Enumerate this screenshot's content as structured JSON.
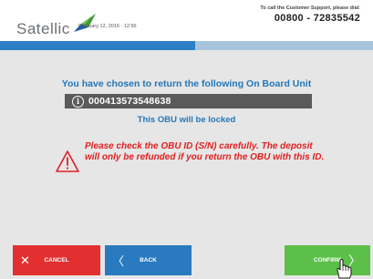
{
  "header": {
    "brand": "Satellic",
    "date": "February 12, 2016 - 12:56",
    "support_label": "To call the Customer Support, please dial:",
    "support_phone": "00800 - 72835542"
  },
  "main": {
    "title": "You have chosen to return the following On Board Unit",
    "info_glyph": "i",
    "obu_id": "000413573548638",
    "locked_text": "This OBU will be locked",
    "warning_text": "Please check the OBU ID (S/N) carefully. The deposit will only be refunded if you return the OBU with this ID."
  },
  "footer": {
    "cancel_label": "CANCEL",
    "back_label": "BACK",
    "confirm_label": "CONFIRM"
  },
  "icons": {
    "cancel": "close-icon",
    "back": "chevron-left-icon",
    "confirm": "chevron-right-icon",
    "warning": "warning-triangle-icon",
    "info": "info-icon",
    "cursor": "hand-pointer-icon"
  },
  "colors": {
    "accent_blue": "#2277b9",
    "progress_dark": "#2c7fc4",
    "progress_light": "#a9c4dd",
    "warning_red": "#e02020",
    "cancel_red": "#e23030",
    "back_blue": "#2a7abf",
    "confirm_green": "#5cbf49",
    "obu_bar": "#5a5a5a",
    "background": "#e6e6e6"
  }
}
